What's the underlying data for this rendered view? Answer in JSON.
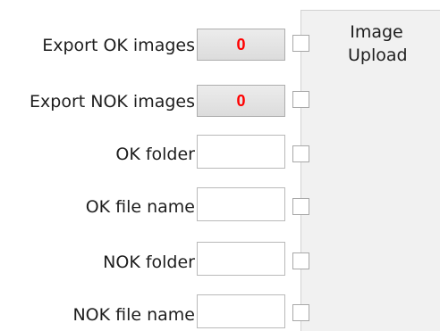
{
  "form": {
    "export_ok": {
      "label": "Export OK images",
      "count": "0"
    },
    "export_nok": {
      "label": "Export NOK images",
      "count": "0"
    },
    "ok_folder": {
      "label": "OK folder",
      "value": ""
    },
    "ok_file_name": {
      "label": "OK file name",
      "value": ""
    },
    "nok_folder": {
      "label": "NOK folder",
      "value": ""
    },
    "nok_file_name": {
      "label": "NOK file name",
      "value": ""
    }
  },
  "side_panel": {
    "title": "Image\nUpload"
  },
  "colors": {
    "counter_text": "#ff0000",
    "panel_background": "#f1f1f1"
  }
}
